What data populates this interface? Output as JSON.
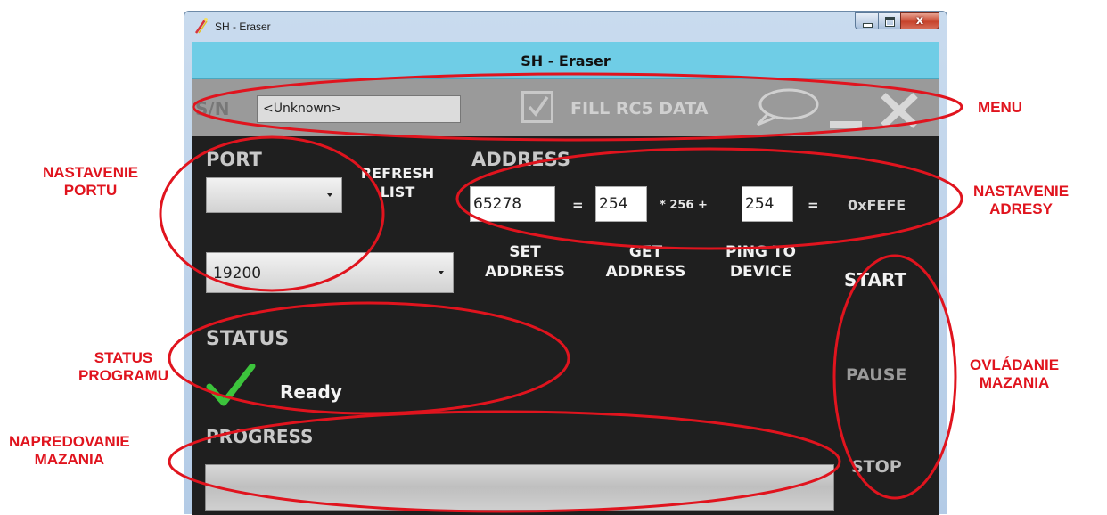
{
  "window": {
    "title": "SH - Eraser",
    "close_glyph": "x"
  },
  "app": {
    "header_title": "SH - Eraser"
  },
  "menu": {
    "sn_label": "S/N",
    "sn_value": "<Unknown>",
    "fill_rc5_label": "FILL RC5 DATA",
    "fill_rc5_checked": true
  },
  "port": {
    "label": "PORT",
    "port_value": "",
    "refresh_line1": "REFRESH",
    "refresh_line2": "LIST",
    "baud_value": "19200"
  },
  "address": {
    "label": "ADDRESS",
    "decimal_value": "65278",
    "equals1": "=",
    "high_byte": "254",
    "multiplier": "* 256 +",
    "low_byte": "254",
    "equals2": "=",
    "hex_value": "0xFEFE",
    "set_line1": "SET",
    "set_line2": "ADDRESS",
    "get_line1": "GET",
    "get_line2": "ADDRESS",
    "ping_line1": "PING TO",
    "ping_line2": "DEVICE"
  },
  "status": {
    "label": "STATUS",
    "text": "Ready"
  },
  "progress": {
    "label": "PROGRESS",
    "percent": 0
  },
  "controls": {
    "start": "START",
    "pause": "PAUSE",
    "stop": "STOP"
  },
  "annotations": {
    "menu": "MENU",
    "port_line1": "NASTAVENIE",
    "port_line2": "PORTU",
    "address_line1": "NASTAVENIE",
    "address_line2": "ADRESY",
    "status_line1": "STATUS",
    "status_line2": "PROGRAMU",
    "control_line1": "OVLÁDANIE",
    "control_line2": "MAZANIA",
    "progress_line1": "NAPREDOVANIE",
    "progress_line2": "MAZANIA"
  },
  "colors": {
    "header": "#6fcde6",
    "menu_bar": "#9a9a9a",
    "client_bg": "#1f1f1f",
    "annotation": "#e0141e",
    "ready_check": "#3cc43c"
  }
}
